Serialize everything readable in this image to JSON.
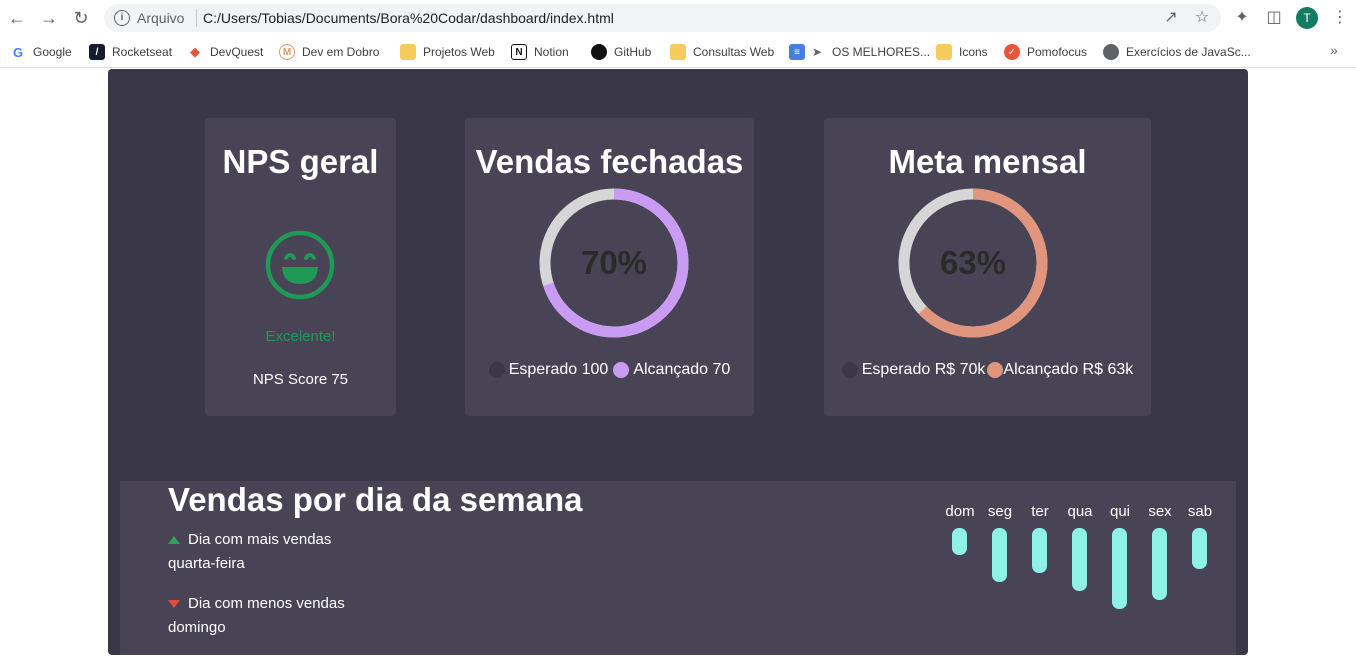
{
  "browser": {
    "address_prefix": "Arquivo",
    "url": "C:/Users/Tobias/Documents/Bora%20Codar/dashboard/index.html",
    "avatar_letter": "T",
    "bookmarks": [
      {
        "label": "Google",
        "icon": "google-icon",
        "color": "#4285f4"
      },
      {
        "label": "Rocketseat",
        "icon": "rocketseat-icon",
        "color": "#1a1a2e"
      },
      {
        "label": "DevQuest",
        "icon": "devquest-icon",
        "color": "#e8553a"
      },
      {
        "label": "Dev em Dobro",
        "icon": "devemdobro-icon",
        "color": "#f0b080"
      },
      {
        "label": "Projetos Web",
        "icon": "folder-icon",
        "color": "#f6cb5e"
      },
      {
        "label": "Notion",
        "icon": "notion-icon",
        "color": "#111111"
      },
      {
        "label": "GitHub",
        "icon": "github-icon",
        "color": "#111111"
      },
      {
        "label": "Consultas Web",
        "icon": "folder-icon",
        "color": "#f6cb5e"
      },
      {
        "label": "OS MELHORES...",
        "icon": "doc-rocket-icon",
        "color": "#4a7dde"
      },
      {
        "label": "Icons",
        "icon": "folder-icon",
        "color": "#f6cb5e"
      },
      {
        "label": "Pomofocus",
        "icon": "check-circle-icon",
        "color": "#e8553a"
      },
      {
        "label": "Exercícios de JavaSc...",
        "icon": "globe-icon",
        "color": "#5f6368"
      }
    ]
  },
  "nps": {
    "title": "NPS geral",
    "status": "Excelente!",
    "score_label": "NPS Score 75",
    "face_icon": "smile-icon",
    "color": "#1f9a56"
  },
  "vendas": {
    "title": "Vendas fechadas",
    "percent_label": "70%",
    "percent": 70,
    "expected_label": "Esperado 100",
    "achieved_label": "Alcançado 70",
    "expected_color": "#3a3748",
    "achieved_color": "#c99bf2",
    "track_color": "#d6d6d6"
  },
  "meta": {
    "title": "Meta mensal",
    "percent_label": "63%",
    "percent": 63,
    "expected_label": "Esperado R$ 70k",
    "achieved_label": "Alcançado R$ 63k",
    "expected_color": "#3a3748",
    "achieved_color": "#e0957c",
    "track_color": "#d6d6d6"
  },
  "week": {
    "title": "Vendas por dia da semana",
    "best_label": "Dia com mais vendas",
    "best_value": "quarta-feira",
    "worst_label": "Dia com menos vendas",
    "worst_value": "domingo",
    "bar_color": "#8ef2e4"
  },
  "chart_data": {
    "type": "bar",
    "categories": [
      "dom",
      "seg",
      "ter",
      "qua",
      "qui",
      "sex",
      "sab"
    ],
    "values": [
      30,
      60,
      50,
      70,
      90,
      80,
      45
    ],
    "title": "",
    "xlabel": "",
    "ylabel": ""
  }
}
